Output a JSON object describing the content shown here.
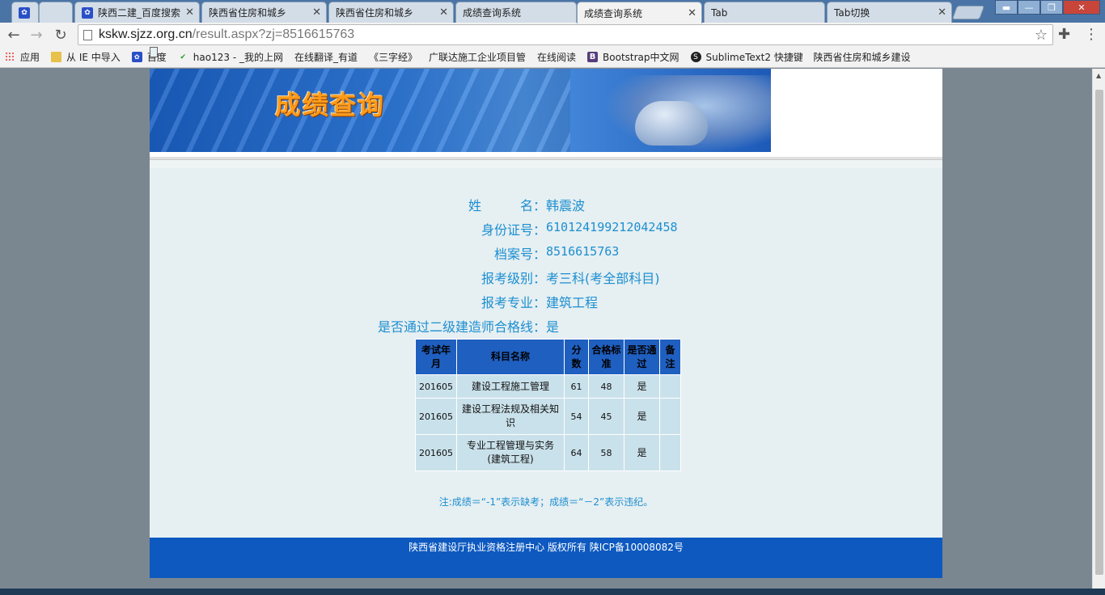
{
  "browser": {
    "tabs": [
      {
        "label": "",
        "icon": "baidu-paw-icon"
      },
      {
        "label": "",
        "icon": "page-icon"
      },
      {
        "label": "陕西二建_百度搜索",
        "icon": "baidu-paw-icon"
      },
      {
        "label": "陕西省住房和城乡",
        "icon": "page-icon"
      },
      {
        "label": "陕西省住房和城乡",
        "icon": "page-icon"
      },
      {
        "label": "成绩查询系统",
        "icon": "page-icon"
      },
      {
        "label": "成绩查询系统",
        "icon": "page-icon",
        "active": true
      },
      {
        "label": "Tab",
        "icon": "page-icon"
      },
      {
        "label": "Tab切换",
        "icon": "page-icon"
      }
    ],
    "address": {
      "host": "kskw.sjzz.org.cn",
      "path": "/result.aspx?zj=8516615763"
    },
    "bookmarks": [
      {
        "label": "应用",
        "icon": "apps-icon"
      },
      {
        "label": "从 IE 中导入",
        "icon": "folder-icon"
      },
      {
        "label": "百度",
        "icon": "baidu-paw-icon"
      },
      {
        "label": "hao123 - _我的上网",
        "icon": "hao123-icon"
      },
      {
        "label": "在线翻译_有道",
        "icon": "page-icon"
      },
      {
        "label": "《三字经》",
        "icon": "page-icon"
      },
      {
        "label": "广联达施工企业项目管",
        "icon": "page-icon"
      },
      {
        "label": "在线阅读",
        "icon": "page-icon"
      },
      {
        "label": "Bootstrap中文网",
        "icon": "bootstrap-icon"
      },
      {
        "label": "SublimeText2 快捷键",
        "icon": "sublime-icon"
      },
      {
        "label": "陕西省住房和城乡建设",
        "icon": "page-icon"
      }
    ]
  },
  "banner": {
    "title": "成绩查询"
  },
  "candidate": {
    "name_label": "姓　　　名：",
    "name": "韩震波",
    "id_label": "身份证号：",
    "id": "610124199212042458",
    "file_label": "档案号：",
    "file": "8516615763",
    "level_label": "报考级别：",
    "level": "考三科(考全部科目)",
    "major_label": "报考专业：",
    "major": "建筑工程",
    "pass_label": "是否通过二级建造师合格线：",
    "pass": "是"
  },
  "scores": {
    "headers": [
      "考试年月",
      "科目名称",
      "分数",
      "合格标准",
      "是否通过",
      "备注"
    ],
    "rows": [
      {
        "date": "201605",
        "subject": "建设工程施工管理",
        "score": "61",
        "standard": "48",
        "passed": "是",
        "remark": ""
      },
      {
        "date": "201605",
        "subject": "建设工程法规及相关知识",
        "score": "54",
        "standard": "45",
        "passed": "是",
        "remark": ""
      },
      {
        "date": "201605",
        "subject": "专业工程管理与实务(建筑工程)",
        "score": "64",
        "standard": "58",
        "passed": "是",
        "remark": ""
      }
    ]
  },
  "note": "注:成绩＝“-1”表示缺考；成绩＝“－2”表示违纪。",
  "footer": "陕西省建设厅执业资格注册中心 版权所有 陕ICP备10008082号",
  "colors": {
    "accent_text": "#1c8fd0",
    "table_header": "#1f5fc0",
    "table_cell": "#c9e1ea",
    "footer_bg": "#0d59c0",
    "banner_title": "#ff9b1a"
  }
}
